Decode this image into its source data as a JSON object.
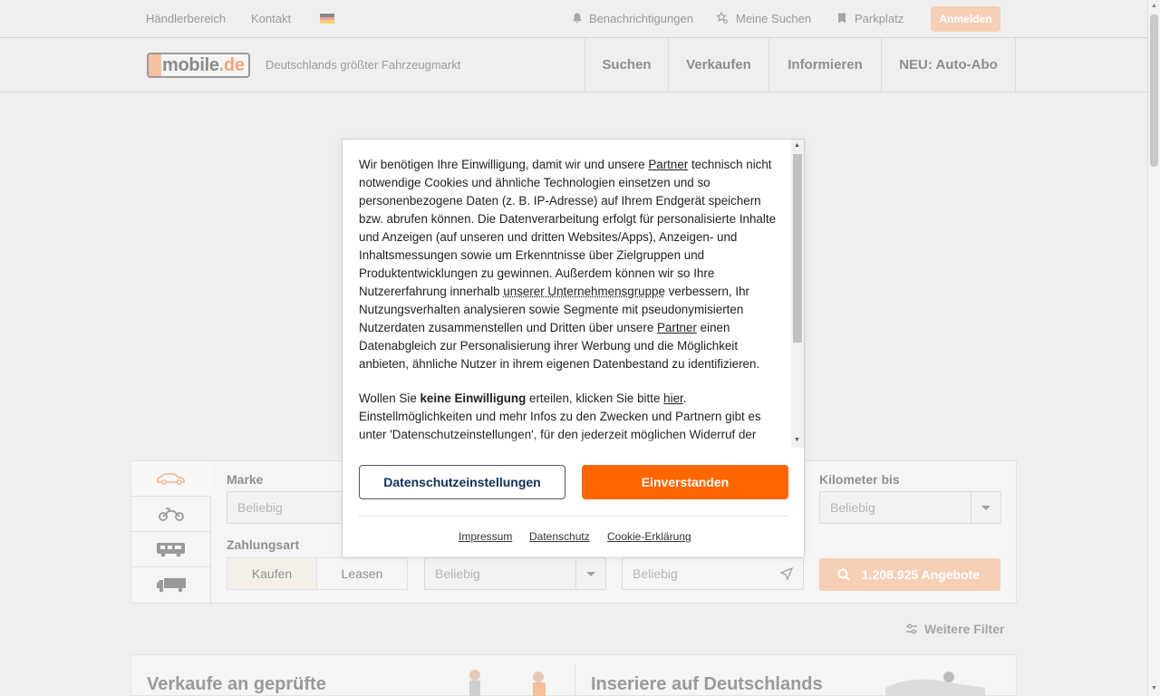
{
  "topbar": {
    "dealer_link": "Händlerbereich",
    "contact_link": "Kontakt",
    "notifications": "Benachrichtigungen",
    "my_searches": "Meine Suchen",
    "parking": "Parkplatz",
    "login": "Anmelden"
  },
  "header": {
    "logo_text": "mobile",
    "logo_suffix": ".de",
    "tagline": "Deutschlands größter Fahrzeugmarkt",
    "nav": [
      "Suchen",
      "Verkaufen",
      "Informieren",
      "NEU: Auto-Abo"
    ]
  },
  "search": {
    "make_label": "Marke",
    "make_value": "Beliebig",
    "payment_label": "Zahlungsart",
    "buy": "Kaufen",
    "lease": "Leasen",
    "rate_value": "Beliebig",
    "location_placeholder": "Beliebig",
    "km_label": "Kilometer bis",
    "km_value": "Beliebig",
    "offers_button": "1.208.925 Angebote",
    "more_filters": "Weitere Filter"
  },
  "teasers": {
    "left": "Verkaufe an geprüfte",
    "right": "Inseriere auf Deutschlands"
  },
  "consent": {
    "p1_a": "Wir benötigen Ihre Einwilligung, damit wir und unsere ",
    "p1_partner": "Partner",
    "p1_b": " technisch nicht notwendige Cookies und ähnliche Technologien einsetzen und so personenbezogene Daten (z. B. IP-Adresse) auf Ihrem Endgerät speichern bzw. abrufen können. Die Datenverarbeitung erfolgt für personalisierte Inhalte und Anzeigen (auf unseren und dritten Websites/Apps), Anzeigen- und Inhaltsmessungen sowie um Erkenntnisse über Zielgruppen und Produktentwicklungen zu gewinnen. Außerdem können wir so Ihre Nutzererfahrung innerhalb ",
    "p1_group": "unserer Unternehmensgruppe",
    "p1_c": " verbessern, Ihr Nutzungsverhalten analysieren sowie Segmente mit pseudonymisierten Nutzerdaten zusammenstellen und Dritten über unsere ",
    "p1_partner2": "Partner",
    "p1_d": " einen Datenabgleich zur Personalisierung ihrer Werbung und die Möglichkeit anbieten, ähnliche Nutzer in ihrem eigenen Datenbestand zu identifizieren.",
    "p2_a": "Wollen Sie ",
    "p2_bold": "keine Einwilligung",
    "p2_b": " erteilen, klicken Sie bitte ",
    "p2_here": "hier",
    "p2_c": ". Einstellmöglichkeiten und mehr Infos zu den Zwecken und Partnern gibt es unter 'Datenschutzeinstellungen', für den jederzeit möglichen Widerruf der Einwilligung und zur 'berechtigten Interessen'.",
    "btn_settings": "Datenschutzeinstellungen",
    "btn_accept": "Einverstanden",
    "link_impressum": "Impressum",
    "link_privacy": "Datenschutz",
    "link_cookie": "Cookie-Erklärung"
  },
  "colors": {
    "accent": "#ff6600",
    "dim_accent": "#f6cfb7",
    "navy": "#0f2e5a"
  }
}
